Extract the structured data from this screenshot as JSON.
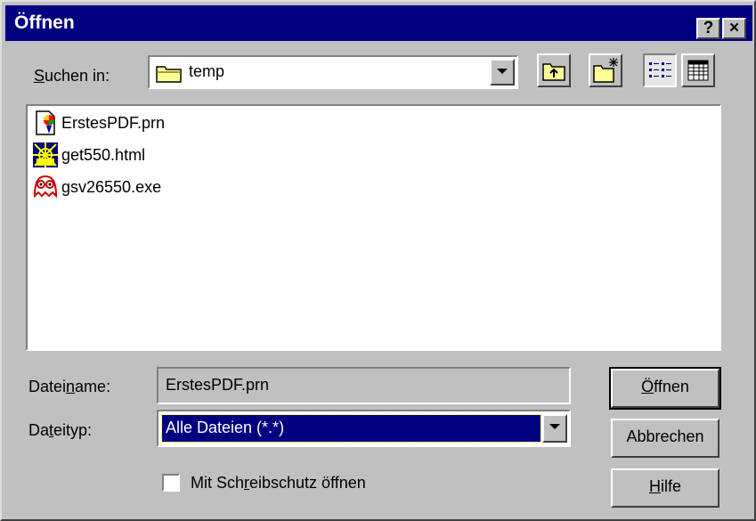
{
  "window": {
    "title": "Öffnen",
    "help_button": "?",
    "close_button": "×"
  },
  "lookin": {
    "label_pre": "",
    "label_u": "S",
    "label_post": "uchen in:",
    "value": "temp",
    "icon": "folder-icon"
  },
  "toolbar": {
    "icons": [
      "up-folder-icon",
      "new-folder-icon",
      "list-view-icon",
      "details-view-icon"
    ]
  },
  "files": [
    {
      "name": "ErstesPDF.prn",
      "icon": "printer-file-icon"
    },
    {
      "name": "get550.html",
      "icon": "html-file-icon"
    },
    {
      "name": "gsv26550.exe",
      "icon": "ghostscript-exe-icon"
    }
  ],
  "filename": {
    "label_pre": "Datei",
    "label_u": "n",
    "label_post": "ame:",
    "value": "ErstesPDF.prn"
  },
  "filetype": {
    "label_pre": "Da",
    "label_u": "t",
    "label_post": "eityp:",
    "value": "Alle Dateien (*.*)"
  },
  "readonly": {
    "label_pre": "Mit Sch",
    "label_u": "r",
    "label_post": "eibschutz öffnen",
    "checked": false
  },
  "buttons": {
    "open_u": "Ö",
    "open_post": "ffnen",
    "cancel": "Abbrechen",
    "help_u": "H",
    "help_post": "ilfe"
  },
  "colors": {
    "titlebar": "#000080",
    "face": "#c0c0c0",
    "selection": "#000080"
  }
}
